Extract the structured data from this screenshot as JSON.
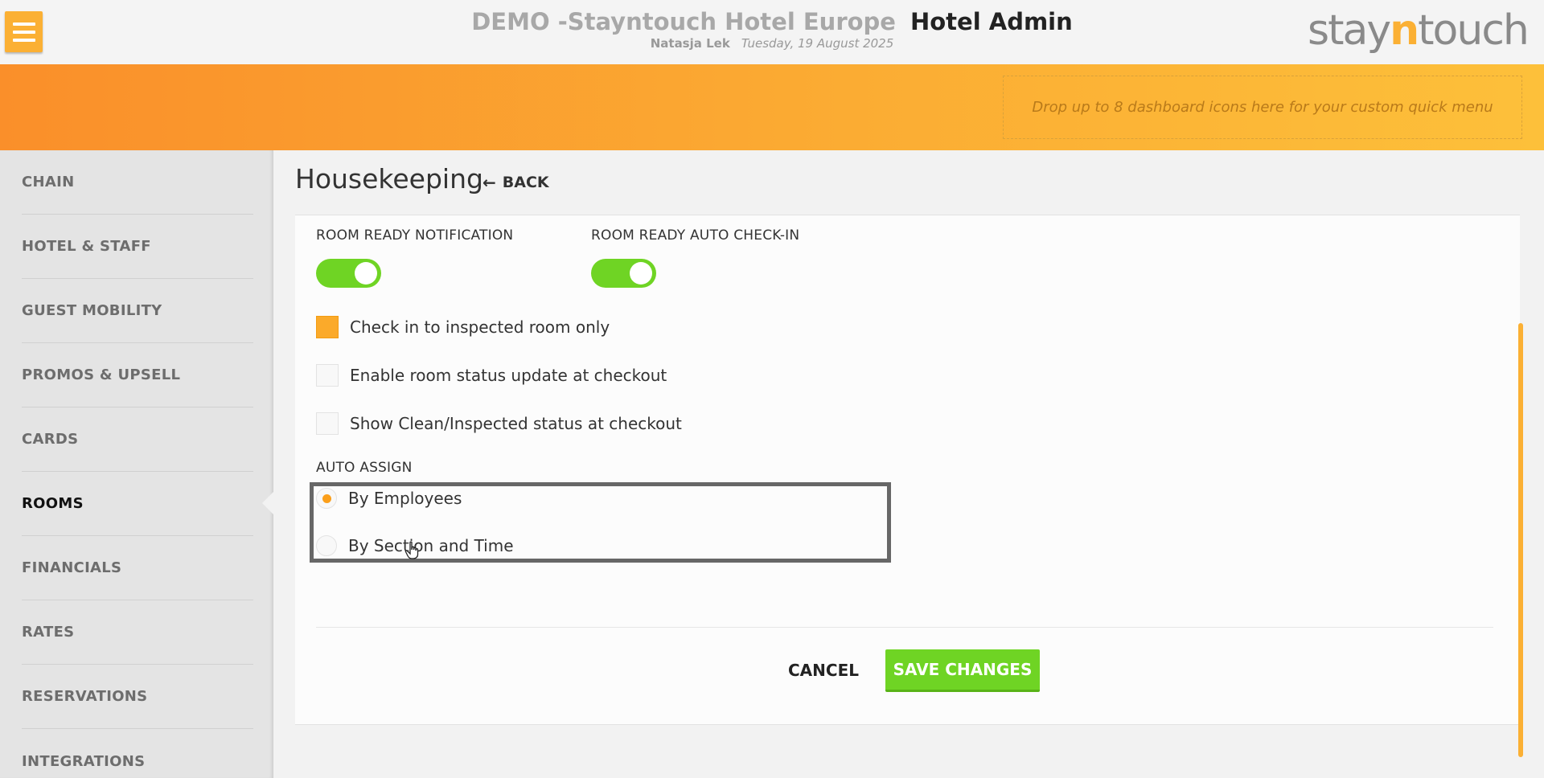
{
  "header": {
    "hotel_name": "DEMO -Stayntouch Hotel Europe",
    "app_name": "Hotel Admin",
    "user_name": "Natasja Lek",
    "date": "Tuesday, 19 August 2025",
    "logo_left": "stay",
    "logo_n": "n",
    "logo_right": "touch",
    "menu_icon": "hamburger-menu-icon"
  },
  "banner": {
    "dropzone_text": "Drop up to 8 dashboard icons here for your custom quick menu"
  },
  "sidebar": {
    "active": "ROOMS",
    "items": [
      {
        "label": "CHAIN"
      },
      {
        "label": "HOTEL & STAFF"
      },
      {
        "label": "GUEST MOBILITY"
      },
      {
        "label": "PROMOS & UPSELL"
      },
      {
        "label": "CARDS"
      },
      {
        "label": "ROOMS"
      },
      {
        "label": "FINANCIALS"
      },
      {
        "label": "RATES"
      },
      {
        "label": "RESERVATIONS"
      },
      {
        "label": "INTEGRATIONS"
      }
    ]
  },
  "main": {
    "page_title": "Housekeeping",
    "back_label": "BACK",
    "room_ready_notification": {
      "label": "ROOM READY NOTIFICATION",
      "on": true
    },
    "room_ready_auto_checkin": {
      "label": "ROOM READY AUTO CHECK-IN",
      "on": true
    },
    "checkboxes": [
      {
        "label": "Check in to inspected room only",
        "checked": true
      },
      {
        "label": "Enable room status update at checkout",
        "checked": false
      },
      {
        "label": "Show Clean/Inspected status at checkout",
        "checked": false
      }
    ],
    "auto_assign": {
      "label": "AUTO ASSIGN",
      "options": [
        {
          "label": "By Employees",
          "selected": true
        },
        {
          "label": "By Section and Time",
          "selected": false
        }
      ]
    },
    "cancel_label": "CANCEL",
    "save_label": "SAVE CHANGES"
  },
  "colors": {
    "accent_orange": "#fbb034",
    "toggle_green": "#6fd424",
    "checkbox_orange": "#fbaa2a"
  }
}
